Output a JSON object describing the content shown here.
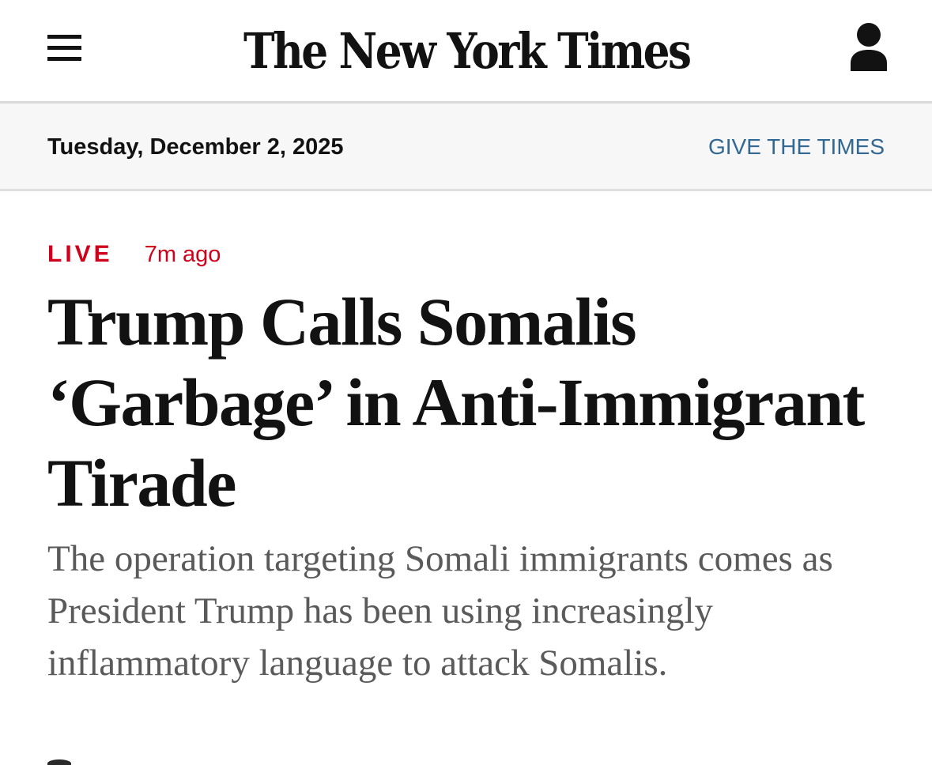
{
  "header": {
    "masthead": "The New York Times",
    "menu_icon": "hamburger-menu-icon",
    "account_icon": "person-icon"
  },
  "datebar": {
    "date": "Tuesday, December 2, 2025",
    "give_link": "GIVE THE TIMES"
  },
  "article": {
    "live_label": "LIVE",
    "timestamp": "7m ago",
    "headline": "Trump Calls Somalis ‘Garbage’ in Anti-Immigrant Tirade",
    "summary": "The operation targeting Somali immigrants comes as President Trump has been using increasingly inflammatory language to attack Somalis."
  },
  "colors": {
    "live_red": "#d0021b",
    "link_blue": "#326891",
    "text_dark": "#121212",
    "summary_gray": "#5a5a5a",
    "datebar_bg": "#f7f7f7"
  }
}
